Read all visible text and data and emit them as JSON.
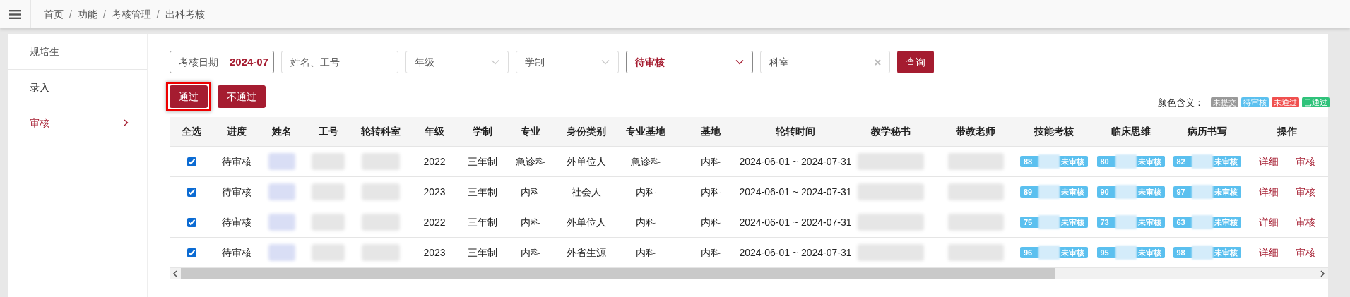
{
  "breadcrumb": {
    "separator": "/",
    "items": [
      "首页",
      "功能",
      "考核管理",
      "出科考核"
    ]
  },
  "sidebar": {
    "title": "规培生",
    "items": [
      {
        "label": "录入",
        "selected": false,
        "has_submenu": false
      },
      {
        "label": "审核",
        "selected": true,
        "has_submenu": true
      }
    ]
  },
  "filters": {
    "date_label": "考核日期",
    "date_value": "2024-07",
    "name_placeholder": "姓名、工号",
    "grade_placeholder": "年级",
    "system_placeholder": "学制",
    "status_value": "待审核",
    "dept_value": "科室",
    "search_button": "查询"
  },
  "actions": [
    {
      "label": "通过",
      "highlighted": true
    },
    {
      "label": "不通过",
      "highlighted": false
    }
  ],
  "legend": {
    "label": "颜色含义：",
    "items": [
      {
        "label": "未提交",
        "color": "#999999"
      },
      {
        "label": "待审核",
        "color": "#5bc0ef"
      },
      {
        "label": "未通过",
        "color": "#f0504f"
      },
      {
        "label": "已通过",
        "color": "#2fc27a"
      }
    ]
  },
  "table": {
    "columns": [
      {
        "label": "全选",
        "kind": "check"
      },
      {
        "label": "进度",
        "kind": "text"
      },
      {
        "label": "姓名",
        "kind": "redacted_link"
      },
      {
        "label": "工号",
        "kind": "redacted"
      },
      {
        "label": "轮转科室",
        "kind": "redacted"
      },
      {
        "label": "年级",
        "kind": "text"
      },
      {
        "label": "学制",
        "kind": "text"
      },
      {
        "label": "专业",
        "kind": "text"
      },
      {
        "label": "身份类别",
        "kind": "text"
      },
      {
        "label": "专业基地",
        "kind": "text"
      },
      {
        "label": "基地",
        "kind": "text"
      },
      {
        "label": "轮转时间",
        "kind": "text"
      },
      {
        "label": "教学秘书",
        "kind": "redacted"
      },
      {
        "label": "带教老师",
        "kind": "redacted"
      },
      {
        "label": "技能考核",
        "kind": "badge"
      },
      {
        "label": "临床思维",
        "kind": "badge"
      },
      {
        "label": "病历书写",
        "kind": "badge"
      },
      {
        "label": "操作",
        "kind": "actions"
      }
    ],
    "rows": [
      {
        "checked": true,
        "texts": [
          "待审核",
          "2022",
          "三年制",
          "急诊科",
          "外单位人",
          "急诊科",
          "内科",
          "2024-06-01 ~ 2024-07-31"
        ],
        "scores": [
          {
            "score": "88",
            "status": "未审核"
          },
          {
            "score": "80",
            "status": "未审核"
          },
          {
            "score": "82",
            "status": "未审核"
          }
        ],
        "actions": [
          "详细",
          "审核"
        ]
      },
      {
        "checked": true,
        "texts": [
          "待审核",
          "2023",
          "三年制",
          "内科",
          "社会人",
          "内科",
          "内科",
          "2024-06-01 ~ 2024-07-31"
        ],
        "scores": [
          {
            "score": "89",
            "status": "未审核"
          },
          {
            "score": "90",
            "status": "未审核"
          },
          {
            "score": "97",
            "status": "未审核"
          }
        ],
        "actions": [
          "详细",
          "审核"
        ]
      },
      {
        "checked": true,
        "texts": [
          "待审核",
          "2022",
          "三年制",
          "内科",
          "外单位人",
          "内科",
          "内科",
          "2024-06-01 ~ 2024-07-31"
        ],
        "scores": [
          {
            "score": "75",
            "status": "未审核"
          },
          {
            "score": "73",
            "status": "未审核"
          },
          {
            "score": "63",
            "status": "未审核"
          }
        ],
        "actions": [
          "详细",
          "审核"
        ]
      },
      {
        "checked": true,
        "texts": [
          "待审核",
          "2023",
          "三年制",
          "内科",
          "外省生源",
          "内科",
          "内科",
          "2024-06-01 ~ 2024-07-31"
        ],
        "scores": [
          {
            "score": "96",
            "status": "未审核"
          },
          {
            "score": "95",
            "status": "未审核"
          },
          {
            "score": "98",
            "status": "未审核"
          }
        ],
        "actions": [
          "详细",
          "审核"
        ]
      }
    ]
  }
}
